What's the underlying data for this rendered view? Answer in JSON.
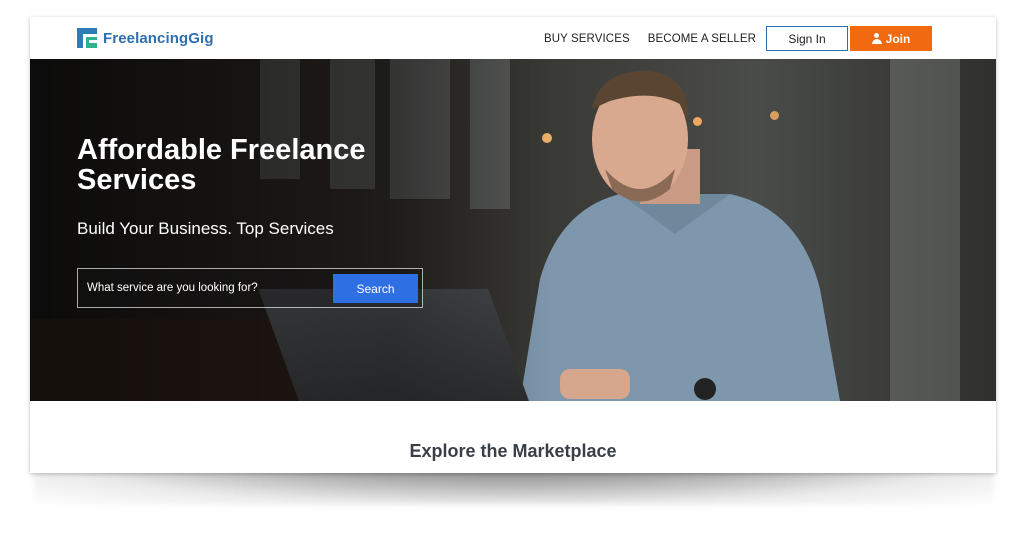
{
  "brand": {
    "name": "FreelancingGig",
    "colors": {
      "primary": "#2f6fae",
      "accent": "#f26a0f",
      "search": "#2f6fe4",
      "logo_green": "#2cb38e"
    }
  },
  "nav": {
    "buy_services": "BUY SERVICES",
    "become_seller": "BECOME A SELLER",
    "sign_in": "Sign In",
    "join": "Join",
    "join_icon": "user-icon"
  },
  "hero": {
    "title": "Affordable Freelance Services",
    "subtitle": "Build Your Business. Top Services",
    "search": {
      "placeholder": "What service are you looking for?",
      "button": "Search"
    }
  },
  "section": {
    "title": "Explore the Marketplace"
  }
}
